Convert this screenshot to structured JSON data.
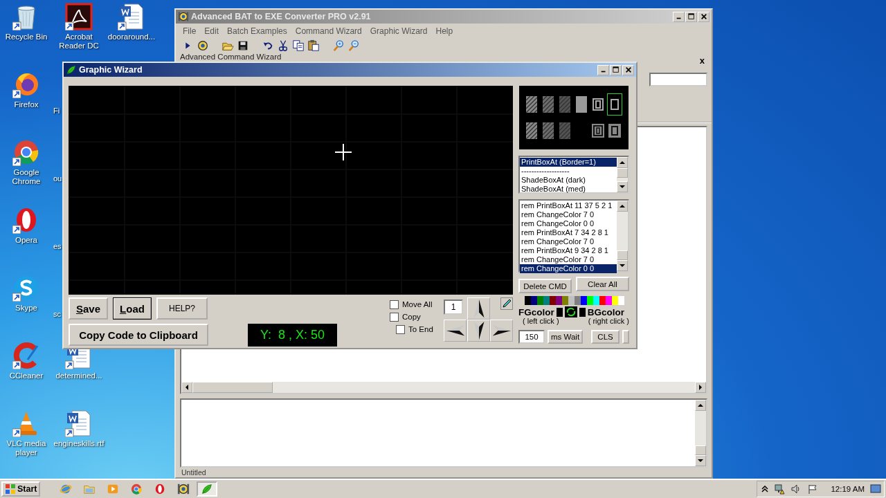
{
  "desktop_icons": [
    {
      "label": "Recycle Bin",
      "kind": "recycle"
    },
    {
      "label": "Firefox",
      "kind": "firefox"
    },
    {
      "label": "Google Chrome",
      "kind": "chrome"
    },
    {
      "label": "Opera",
      "kind": "opera"
    },
    {
      "label": "Skype",
      "kind": "skype"
    },
    {
      "label": "CCleaner",
      "kind": "ccleaner"
    },
    {
      "label": "VLC media player",
      "kind": "vlc"
    },
    {
      "label": "Acrobat Reader DC",
      "kind": "acrobat"
    },
    {
      "label": "Fi",
      "kind": "partial"
    },
    {
      "label": "ou",
      "kind": "partial"
    },
    {
      "label": "es",
      "kind": "partial"
    },
    {
      "label": "sc",
      "kind": "partial"
    },
    {
      "label": "determined...",
      "kind": "word"
    },
    {
      "label": "engineskills.rtf",
      "kind": "word"
    },
    {
      "label": "dooraround...",
      "kind": "word"
    }
  ],
  "main_window": {
    "title": "Advanced BAT to EXE Converter PRO v2.91",
    "menu": [
      "File",
      "Edit",
      "Batch Examples",
      "Command Wizard",
      "Graphic Wizard",
      "Help"
    ],
    "group_label": "Advanced Command Wizard",
    "close_label": "x",
    "status": "Untitled"
  },
  "graphic_wizard": {
    "title": "Graphic Wizard",
    "save": "Save",
    "load": "Load",
    "help": "HELP?",
    "copy_code": "Copy Code to Clipboard",
    "coordinates": "Y:  8 , X: 50",
    "checkboxes": [
      {
        "label": "Move All",
        "checked": false
      },
      {
        "label": "Copy",
        "checked": false
      },
      {
        "label": "To End",
        "checked": false
      }
    ],
    "step": "1",
    "box_styles": [
      {
        "kind": "shade-dark",
        "selected": false
      },
      {
        "kind": "shade-med",
        "selected": false
      },
      {
        "kind": "shade-light",
        "selected": false
      },
      {
        "kind": "solid",
        "selected": false
      },
      {
        "kind": "double",
        "selected": false
      },
      {
        "kind": "single",
        "selected": true
      },
      {
        "kind": "shade-dark",
        "selected": false
      },
      {
        "kind": "shade-med",
        "selected": false
      },
      {
        "kind": "shade-light",
        "selected": false
      },
      {
        "kind": "double-filled",
        "selected": false
      },
      {
        "kind": "single-filled",
        "selected": false
      }
    ],
    "command_types": [
      {
        "label": "PrintBoxAt (Border=1)",
        "selected": true
      },
      {
        "label": "-------------------",
        "selected": false
      },
      {
        "label": "ShadeBoxAt (dark)",
        "selected": false
      },
      {
        "label": "ShadeBoxAt (med)",
        "selected": false
      }
    ],
    "commands": [
      {
        "label": "rem PrintBoxAt 11 37 5 2 1",
        "selected": false
      },
      {
        "label": "rem ChangeColor 7 0",
        "selected": false
      },
      {
        "label": "rem ChangeColor 0 0",
        "selected": false
      },
      {
        "label": "rem PrintBoxAt 7 34 2 8 1",
        "selected": false
      },
      {
        "label": "rem ChangeColor 7 0",
        "selected": false
      },
      {
        "label": "rem PrintBoxAt 9 34 2 8 1",
        "selected": false
      },
      {
        "label": "rem ChangeColor 7 0",
        "selected": false
      },
      {
        "label": "rem ChangeColor 0 0",
        "selected": true
      }
    ],
    "delete_cmd": "Delete CMD",
    "clear_all": "Clear All",
    "palette": [
      {
        "color": "#000000"
      },
      {
        "color": "#000080"
      },
      {
        "color": "#008000"
      },
      {
        "color": "#008080"
      },
      {
        "color": "#800000"
      },
      {
        "color": "#800080"
      },
      {
        "color": "#808000"
      },
      {
        "color": "#c0c0c0"
      },
      {
        "color": "#808080"
      },
      {
        "color": "#0000ff"
      },
      {
        "color": "#00ff00"
      },
      {
        "color": "#00ffff"
      },
      {
        "color": "#ff0000"
      },
      {
        "color": "#ff00ff"
      },
      {
        "color": "#ffff00"
      },
      {
        "color": "#ffffff"
      }
    ],
    "fg_label": "FGcolor",
    "fg_hint": "( left click )",
    "bg_label": "BGcolor",
    "bg_hint": "( right click )",
    "wait": "150",
    "wait_label": "ms Wait",
    "cls": "CLS"
  },
  "taskbar": {
    "start": "Start",
    "apps": [
      {
        "kind": "ie",
        "selected": false
      },
      {
        "kind": "folder",
        "selected": false
      },
      {
        "kind": "media",
        "selected": false
      },
      {
        "kind": "chrome",
        "selected": false
      },
      {
        "kind": "opera",
        "selected": false
      },
      {
        "kind": "converter",
        "selected": false
      },
      {
        "kind": "leaf",
        "selected": true
      }
    ],
    "time": "12:19 AM"
  }
}
